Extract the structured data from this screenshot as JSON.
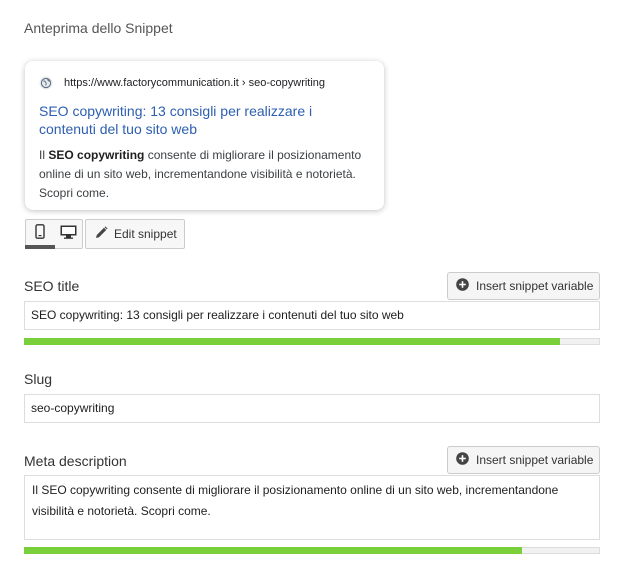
{
  "section_title": "Anteprima dello Snippet",
  "snippet": {
    "url": "https://www.factorycommunication.it › seo-copywriting",
    "title": "SEO copywriting: 13 consigli per realizzare i contenuti del tuo sito web",
    "desc_bold": "SEO copywriting",
    "desc_rest": " consente di migliorare il posizionamento online di un sito web, incrementandone visibilità e notorietà. Scopri come.",
    "desc_prefix": "Il "
  },
  "mode": {
    "mobile_icon": "mobile-icon",
    "desktop_icon": "desktop-icon",
    "active": "mobile"
  },
  "edit_snippet_label": "Edit snippet",
  "seo_title": {
    "label": "SEO title",
    "insert_label": "Insert snippet variable",
    "value": "SEO copywriting: 13 consigli per realizzare i contenuti del tuo sito web",
    "progress": 0.93
  },
  "slug": {
    "label": "Slug",
    "value": "seo-copywriting"
  },
  "meta_description": {
    "label": "Meta description",
    "insert_label": "Insert snippet variable",
    "value": "Il SEO copywriting consente di migliorare il posizionamento online di un sito web, incrementandone visibilità e notorietà. Scopri come.",
    "progress": 0.865
  },
  "colors": {
    "progress_good": "#7ad03a",
    "link_title": "#2c5fb0"
  }
}
